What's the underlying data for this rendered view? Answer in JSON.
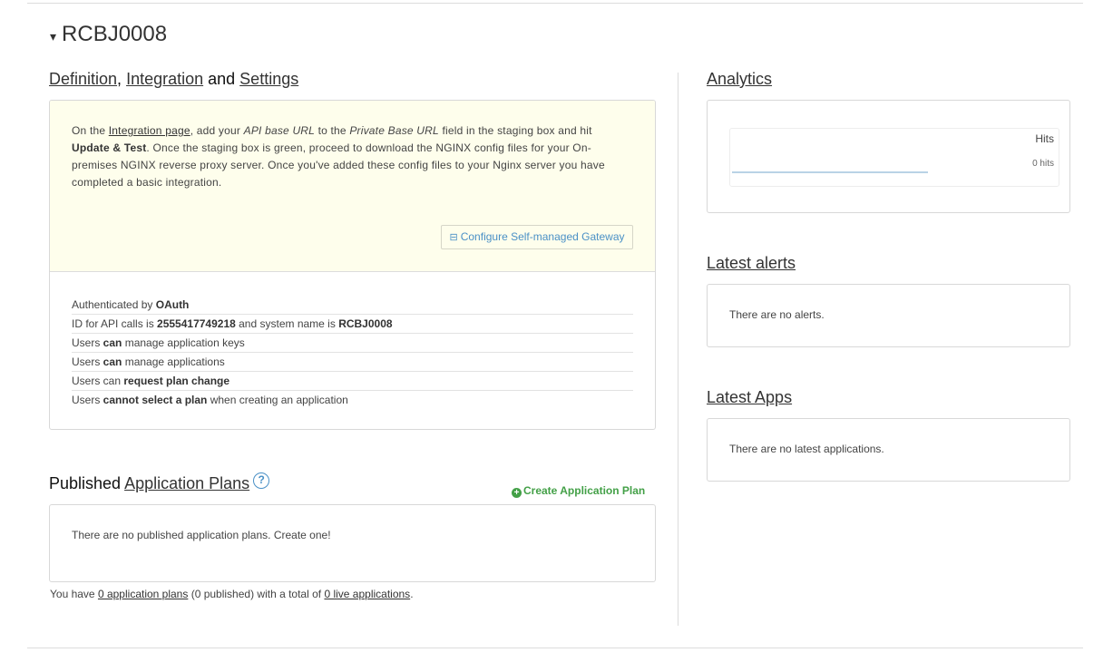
{
  "service": {
    "caret": "▾",
    "name": "RCBJ0008"
  },
  "definition": {
    "heading": {
      "link1": "Definition",
      "sep1": ", ",
      "link2": "Integration",
      "sep2": " and ",
      "link3": "Settings"
    },
    "info": {
      "p1": "On the ",
      "integration_link": "Integration page",
      "p2": ", add your ",
      "api_base_url": "API base URL",
      "p3": " to the ",
      "private_base_url": "Private Base URL",
      "p4": " field in the staging box and hit ",
      "update_test": "Update & Test",
      "p5": ". Once the staging box is green, proceed to download the NGINX config files for your On-premises NGINX reverse proxy server. Once you've added these config files to your Nginx server you have completed a basic integration."
    },
    "gateway_button": {
      "icon": "⊟",
      "label": "Configure Self-managed Gateway"
    },
    "settings": {
      "auth_prefix": "Authenticated by ",
      "auth_value": "OAuth",
      "id_prefix": "ID for API calls is ",
      "id_value": "2555417749218",
      "id_mid": " and system name is ",
      "system_name": "RCBJ0008",
      "keys_prefix": "Users ",
      "keys_strong": "can",
      "keys_suffix": " manage application keys",
      "apps_prefix": "Users ",
      "apps_strong": "can",
      "apps_suffix": " manage applications",
      "plan_prefix": "Users can ",
      "plan_strong": "request plan change",
      "select_prefix": "Users ",
      "select_strong": "cannot select a plan",
      "select_suffix": " when creating an application"
    }
  },
  "plans": {
    "heading_prefix": "Published ",
    "heading_link": "Application Plans",
    "help_icon": "?",
    "create_plus": "+",
    "create_label": "Create Application Plan",
    "empty_text": "There are no published application plans. Create one!",
    "summary": {
      "p1": "You have ",
      "plans_link": "0 application plans",
      "p2": " (0 published) with a total of ",
      "apps_link": "0 live applications",
      "p3": "."
    }
  },
  "analytics": {
    "heading": "Analytics",
    "metric": "Hits",
    "value": "0 hits"
  },
  "alerts": {
    "heading": "Latest alerts",
    "empty_text": "There are no alerts."
  },
  "latest_apps": {
    "heading": "Latest Apps",
    "empty_text": "There are no latest applications."
  },
  "colors": {
    "accent_blue": "#4a90c6",
    "create_green": "#43a047",
    "info_bg": "#fefeec"
  }
}
